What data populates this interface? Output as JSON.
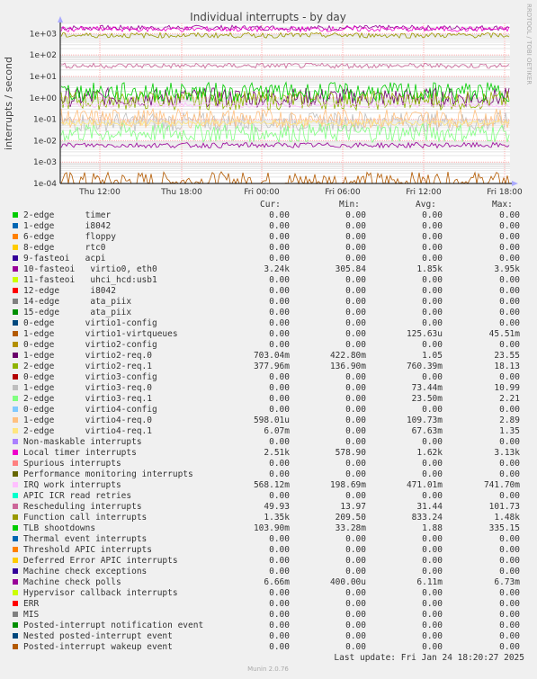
{
  "chart_data": {
    "type": "line",
    "title": "Individual interrupts - by day",
    "ylabel": "interrupts / second",
    "y_scale": "log",
    "ylim": [
      0.0001,
      3000
    ],
    "y_ticks": [
      "1e-04",
      "1e-03",
      "1e-02",
      "1e-01",
      "1e+00",
      "1e+01",
      "1e+02",
      "1e+03"
    ],
    "x_ticks": [
      "Thu 12:00",
      "Thu 18:00",
      "Fri 00:00",
      "Fri 06:00",
      "Fri 12:00",
      "Fri 18:00"
    ],
    "grid": true,
    "side_label": "RRDTOOL / TOBI OETIKER",
    "footer": "Munin 2.0.76",
    "columns": [
      "Cur:",
      "Min:",
      "Avg:",
      "Max:"
    ],
    "series": [
      {
        "name": "2-edge      timer",
        "color": "#00cc00",
        "cur": "0.00",
        "min": "0.00",
        "avg": "0.00",
        "max": "0.00"
      },
      {
        "name": "1-edge      i8042",
        "color": "#0066b3",
        "cur": "0.00",
        "min": "0.00",
        "avg": "0.00",
        "max": "0.00"
      },
      {
        "name": "6-edge      floppy",
        "color": "#ff8000",
        "cur": "0.00",
        "min": "0.00",
        "avg": "0.00",
        "max": "0.00"
      },
      {
        "name": "8-edge      rtc0",
        "color": "#ffcc00",
        "cur": "0.00",
        "min": "0.00",
        "avg": "0.00",
        "max": "0.00"
      },
      {
        "name": "9-fasteoi   acpi",
        "color": "#330099",
        "cur": "0.00",
        "min": "0.00",
        "avg": "0.00",
        "max": "0.00"
      },
      {
        "name": "10-fasteoi   virtio0, eth0",
        "color": "#990099",
        "cur": "3.24k",
        "min": "305.84",
        "avg": "1.85k",
        "max": "3.95k"
      },
      {
        "name": "11-fasteoi   uhci_hcd:usb1",
        "color": "#ccff00",
        "cur": "0.00",
        "min": "0.00",
        "avg": "0.00",
        "max": "0.00"
      },
      {
        "name": "12-edge      i8042",
        "color": "#ff0000",
        "cur": "0.00",
        "min": "0.00",
        "avg": "0.00",
        "max": "0.00"
      },
      {
        "name": "14-edge      ata_piix",
        "color": "#808080",
        "cur": "0.00",
        "min": "0.00",
        "avg": "0.00",
        "max": "0.00"
      },
      {
        "name": "15-edge      ata_piix",
        "color": "#008f00",
        "cur": "0.00",
        "min": "0.00",
        "avg": "0.00",
        "max": "0.00"
      },
      {
        "name": "0-edge      virtio1-config",
        "color": "#00487d",
        "cur": "0.00",
        "min": "0.00",
        "avg": "0.00",
        "max": "0.00"
      },
      {
        "name": "1-edge      virtio1-virtqueues",
        "color": "#b35a00",
        "cur": "0.00",
        "min": "0.00",
        "avg": "125.63u",
        "max": "45.51m"
      },
      {
        "name": "0-edge      virtio2-config",
        "color": "#b38f00",
        "cur": "0.00",
        "min": "0.00",
        "avg": "0.00",
        "max": "0.00"
      },
      {
        "name": "1-edge      virtio2-req.0",
        "color": "#6b006b",
        "cur": "703.04m",
        "min": "422.80m",
        "avg": "1.05",
        "max": "23.55"
      },
      {
        "name": "2-edge      virtio2-req.1",
        "color": "#8fb300",
        "cur": "377.96m",
        "min": "136.90m",
        "avg": "760.39m",
        "max": "18.13"
      },
      {
        "name": "0-edge      virtio3-config",
        "color": "#b30000",
        "cur": "0.00",
        "min": "0.00",
        "avg": "0.00",
        "max": "0.00"
      },
      {
        "name": "1-edge      virtio3-req.0",
        "color": "#bebebe",
        "cur": "0.00",
        "min": "0.00",
        "avg": "73.44m",
        "max": "10.99"
      },
      {
        "name": "2-edge      virtio3-req.1",
        "color": "#80ff80",
        "cur": "0.00",
        "min": "0.00",
        "avg": "23.50m",
        "max": "2.21"
      },
      {
        "name": "0-edge      virtio4-config",
        "color": "#80c9ff",
        "cur": "0.00",
        "min": "0.00",
        "avg": "0.00",
        "max": "0.00"
      },
      {
        "name": "1-edge      virtio4-req.0",
        "color": "#ffc080",
        "cur": "598.01u",
        "min": "0.00",
        "avg": "109.73m",
        "max": "2.89"
      },
      {
        "name": "2-edge      virtio4-req.1",
        "color": "#ffe680",
        "cur": "6.07m",
        "min": "0.00",
        "avg": "67.63m",
        "max": "1.35"
      },
      {
        "name": "Non-maskable interrupts",
        "color": "#aa80ff",
        "cur": "0.00",
        "min": "0.00",
        "avg": "0.00",
        "max": "0.00"
      },
      {
        "name": "Local timer interrupts",
        "color": "#ee00cc",
        "cur": "2.51k",
        "min": "578.90",
        "avg": "1.62k",
        "max": "3.13k"
      },
      {
        "name": "Spurious interrupts",
        "color": "#ff8080",
        "cur": "0.00",
        "min": "0.00",
        "avg": "0.00",
        "max": "0.00"
      },
      {
        "name": "Performance monitoring interrupts",
        "color": "#666600",
        "cur": "0.00",
        "min": "0.00",
        "avg": "0.00",
        "max": "0.00"
      },
      {
        "name": "IRQ work interrupts",
        "color": "#ffbfff",
        "cur": "568.12m",
        "min": "198.69m",
        "avg": "471.01m",
        "max": "741.70m"
      },
      {
        "name": "APIC ICR read retries",
        "color": "#00ffcc",
        "cur": "0.00",
        "min": "0.00",
        "avg": "0.00",
        "max": "0.00"
      },
      {
        "name": "Rescheduling interrupts",
        "color": "#cc6699",
        "cur": "49.93",
        "min": "13.97",
        "avg": "31.44",
        "max": "101.73"
      },
      {
        "name": "Function call interrupts",
        "color": "#999900",
        "cur": "1.35k",
        "min": "209.50",
        "avg": "833.24",
        "max": "1.48k"
      },
      {
        "name": "TLB shootdowns",
        "color": "#00cc00",
        "cur": "103.90m",
        "min": "33.28m",
        "avg": "1.88",
        "max": "335.15"
      },
      {
        "name": "Thermal event interrupts",
        "color": "#0066b3",
        "cur": "0.00",
        "min": "0.00",
        "avg": "0.00",
        "max": "0.00"
      },
      {
        "name": "Threshold APIC interrupts",
        "color": "#ff8000",
        "cur": "0.00",
        "min": "0.00",
        "avg": "0.00",
        "max": "0.00"
      },
      {
        "name": "Deferred Error APIC interrupts",
        "color": "#ffcc00",
        "cur": "0.00",
        "min": "0.00",
        "avg": "0.00",
        "max": "0.00"
      },
      {
        "name": "Machine check exceptions",
        "color": "#330099",
        "cur": "0.00",
        "min": "0.00",
        "avg": "0.00",
        "max": "0.00"
      },
      {
        "name": "Machine check polls",
        "color": "#990099",
        "cur": "6.66m",
        "min": "400.00u",
        "avg": "6.11m",
        "max": "6.73m"
      },
      {
        "name": "Hypervisor callback interrupts",
        "color": "#ccff00",
        "cur": "0.00",
        "min": "0.00",
        "avg": "0.00",
        "max": "0.00"
      },
      {
        "name": "ERR",
        "color": "#ff0000",
        "cur": "0.00",
        "min": "0.00",
        "avg": "0.00",
        "max": "0.00"
      },
      {
        "name": "MIS",
        "color": "#808080",
        "cur": "0.00",
        "min": "0.00",
        "avg": "0.00",
        "max": "0.00"
      },
      {
        "name": "Posted-interrupt notification event",
        "color": "#008f00",
        "cur": "0.00",
        "min": "0.00",
        "avg": "0.00",
        "max": "0.00"
      },
      {
        "name": "Nested posted-interrupt event",
        "color": "#00487d",
        "cur": "0.00",
        "min": "0.00",
        "avg": "0.00",
        "max": "0.00"
      },
      {
        "name": "Posted-interrupt wakeup event",
        "color": "#b35a00",
        "cur": "0.00",
        "min": "0.00",
        "avg": "0.00",
        "max": "0.00"
      }
    ],
    "last_update": "Last update: Fri Jan 24 18:20:27 2025"
  }
}
